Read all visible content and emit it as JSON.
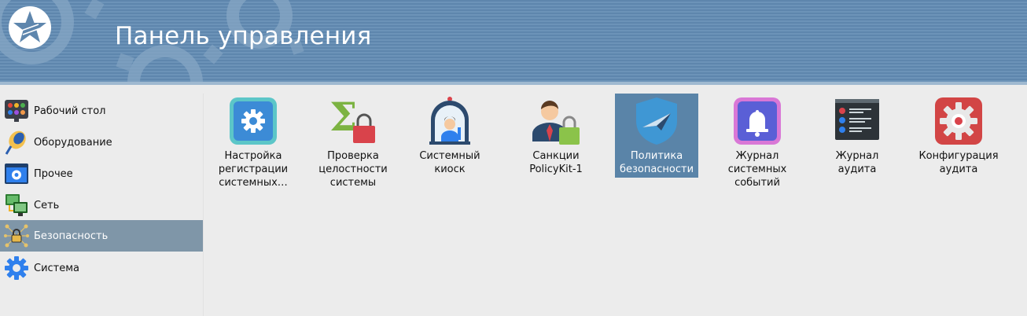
{
  "header": {
    "title": "Панель управления"
  },
  "sidebar": {
    "items": [
      {
        "label": "Рабочий стол",
        "icon": "desktop-palette-icon"
      },
      {
        "label": "Оборудование",
        "icon": "hardware-mouse-icon"
      },
      {
        "label": "Прочее",
        "icon": "other-gear-window-icon"
      },
      {
        "label": "Сеть",
        "icon": "network-monitors-icon"
      },
      {
        "label": "Безопасность",
        "icon": "security-network-lock-icon",
        "active": true
      },
      {
        "label": "Система",
        "icon": "system-gear-icon"
      }
    ]
  },
  "main": {
    "tiles": [
      {
        "label": "Настройка регистрации системных…",
        "icon": "audit-registration-gear-icon"
      },
      {
        "label": "Проверка целостности системы",
        "icon": "integrity-sigma-lock-icon"
      },
      {
        "label": "Системный киоск",
        "icon": "kiosk-person-dome-icon"
      },
      {
        "label": "Санкции PolicyKit-1",
        "icon": "policykit-person-lock-icon"
      },
      {
        "label": "Политика безопасности",
        "icon": "security-policy-shield-icon",
        "selected": true
      },
      {
        "label": "Журнал системных событий",
        "icon": "event-log-bell-icon"
      },
      {
        "label": "Журнал аудита",
        "icon": "audit-log-terminal-icon"
      },
      {
        "label": "Конфигурация аудита",
        "icon": "audit-config-gear-icon"
      }
    ]
  },
  "colors": {
    "header": "#6a90b6",
    "selected": "#5a84a8",
    "sidebar_active": "#7f96a8",
    "background": "#ececec"
  }
}
